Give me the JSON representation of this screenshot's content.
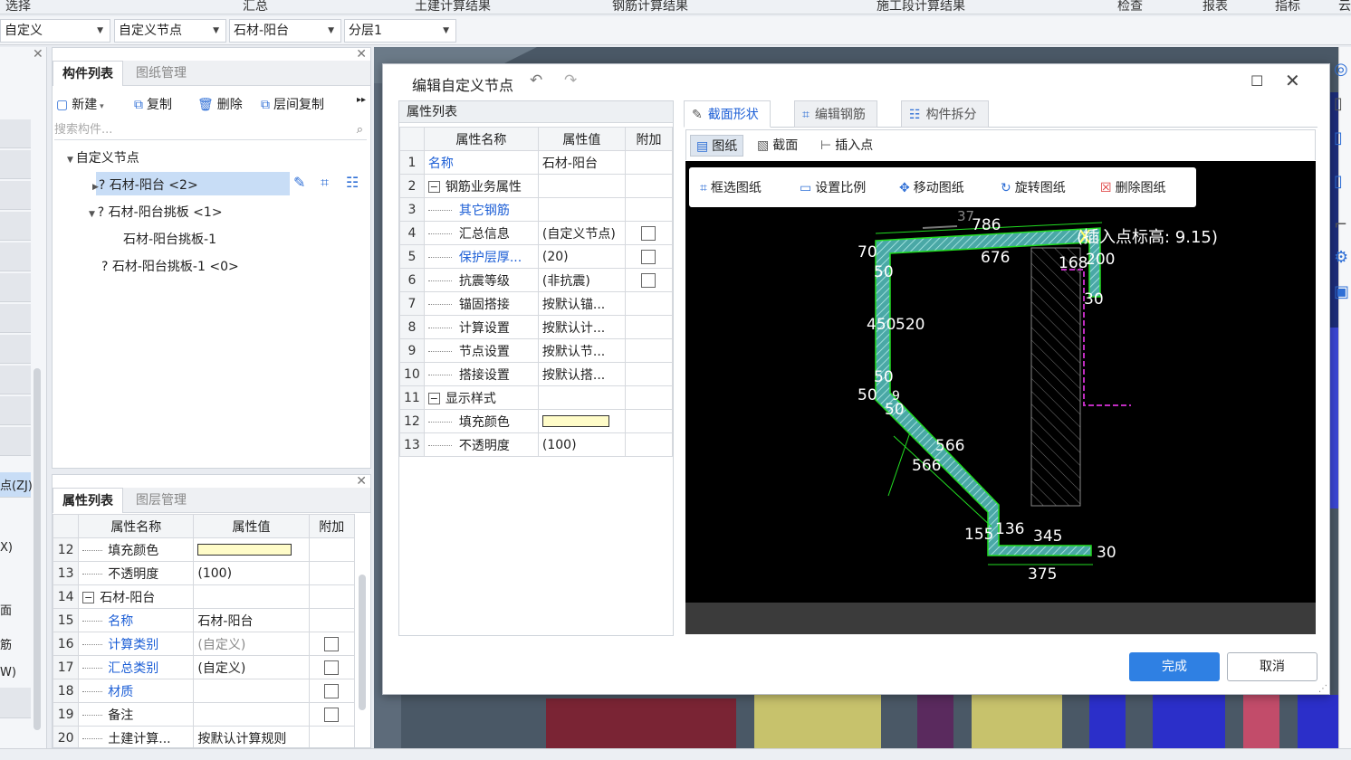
{
  "menu": {
    "items": [
      "选择",
      "汇总",
      "土建计算结果",
      "钢筋计算结果",
      "施工段计算结果",
      "检查",
      "报表",
      "指标",
      "云"
    ]
  },
  "selectors": {
    "values": [
      "自定义",
      "自定义节点",
      "石材-阳台",
      "分层1"
    ]
  },
  "left_strip": {
    "labels": [
      "点(ZJ)",
      "X)",
      "面",
      "筋",
      "W)"
    ]
  },
  "component_panel": {
    "tabs": [
      "构件列表",
      "图纸管理"
    ],
    "toolbar": {
      "new": "新建",
      "copy": "复制",
      "delete": "删除",
      "floor_copy": "层间复制"
    },
    "search_placeholder": "搜索构件...",
    "tree": [
      "自定义节点",
      "? 石材-阳台 <2>",
      "? 石材-阳台挑板 <1>",
      "石材-阳台挑板-1",
      "? 石材-阳台挑板-1 <0>"
    ]
  },
  "prop_panel": {
    "tabs": [
      "属性列表",
      "图层管理"
    ],
    "headers": [
      "属性名称",
      "属性值",
      "附加"
    ],
    "rows": [
      {
        "n": "12",
        "name": "填充颜色",
        "value": "",
        "swatch": true,
        "cb": false,
        "blue": false
      },
      {
        "n": "13",
        "name": "不透明度",
        "value": "(100)",
        "cb": false,
        "blue": false
      },
      {
        "n": "14",
        "name": "石材-阳台",
        "value": "",
        "cb": false,
        "blue": false,
        "group": true
      },
      {
        "n": "15",
        "name": "名称",
        "value": "石材-阳台",
        "cb": false,
        "blue": true
      },
      {
        "n": "16",
        "name": "计算类别",
        "value": "(自定义)",
        "cb": true,
        "blue": true,
        "grayval": true
      },
      {
        "n": "17",
        "name": "汇总类别",
        "value": "(自定义)",
        "cb": true,
        "blue": true
      },
      {
        "n": "18",
        "name": "材质",
        "value": "",
        "cb": true,
        "blue": true
      },
      {
        "n": "19",
        "name": "备注",
        "value": "",
        "cb": true,
        "blue": false
      },
      {
        "n": "20",
        "name": "土建计算...",
        "value": "按默认计算规则",
        "cb": false,
        "blue": false
      }
    ]
  },
  "dialog": {
    "title": "编辑自定义节点",
    "attr_header": "属性列表",
    "attr_columns": [
      "属性名称",
      "属性值",
      "附加"
    ],
    "attr_rows": [
      {
        "n": "1",
        "name": "名称",
        "value": "石材-阳台",
        "blue": true,
        "indent": 0,
        "cb": false
      },
      {
        "n": "2",
        "name": "钢筋业务属性",
        "value": "",
        "group": true,
        "indent": 0,
        "cb": false
      },
      {
        "n": "3",
        "name": "其它钢筋",
        "value": "",
        "blue": true,
        "indent": 2,
        "cb": false
      },
      {
        "n": "4",
        "name": "汇总信息",
        "value": "(自定义节点)",
        "indent": 2,
        "cb": true
      },
      {
        "n": "5",
        "name": "保护层厚...",
        "value": "(20)",
        "blue": true,
        "indent": 2,
        "cb": true
      },
      {
        "n": "6",
        "name": "抗震等级",
        "value": "(非抗震)",
        "indent": 2,
        "cb": true
      },
      {
        "n": "7",
        "name": "锚固搭接",
        "value": "按默认锚...",
        "indent": 2,
        "cb": false
      },
      {
        "n": "8",
        "name": "计算设置",
        "value": "按默认计...",
        "indent": 2,
        "cb": false
      },
      {
        "n": "9",
        "name": "节点设置",
        "value": "按默认节...",
        "indent": 2,
        "cb": false
      },
      {
        "n": "10",
        "name": "搭接设置",
        "value": "按默认搭...",
        "indent": 2,
        "cb": false
      },
      {
        "n": "11",
        "name": "显示样式",
        "value": "",
        "group": true,
        "indent": 0,
        "cb": false
      },
      {
        "n": "12",
        "name": "填充颜色",
        "value": "",
        "swatch": true,
        "indent": 2,
        "cb": false
      },
      {
        "n": "13",
        "name": "不透明度",
        "value": "(100)",
        "indent": 2,
        "cb": false
      }
    ],
    "right_tabs": [
      "截面形状",
      "编辑钢筋",
      "构件拆分"
    ],
    "sub_tabs": [
      "图纸",
      "截面",
      "插入点"
    ],
    "float_tools": [
      "框选图纸",
      "设置比例",
      "移动图纸",
      "旋转图纸",
      "删除图纸"
    ],
    "drawing_labels": [
      "786",
      "676",
      "70",
      "50",
      "168",
      "200",
      "30",
      "450",
      "520",
      "50",
      "50",
      "50",
      "9",
      "566",
      "566",
      "155",
      "136",
      "345",
      "30",
      "375",
      "37"
    ],
    "insert_label": "(插入点标高: 9.15)",
    "ok": "完成",
    "cancel": "取消"
  },
  "colors": {
    "accent": "#2f80e3",
    "canvas": "#000000",
    "hatch": "#6fc4c0",
    "dim": "#22dd22",
    "fill_color": "#fffcc8"
  }
}
